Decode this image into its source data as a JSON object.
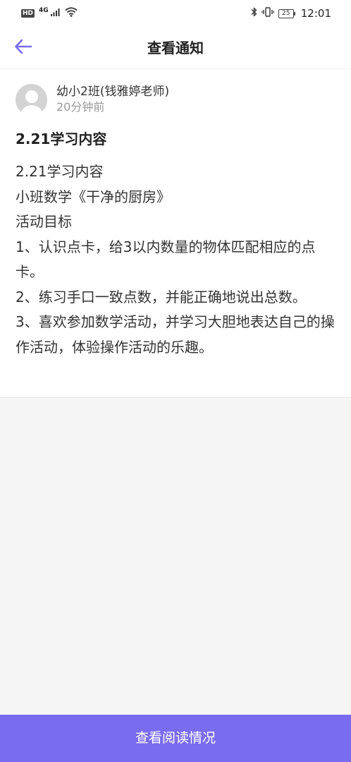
{
  "status_bar": {
    "hd": "HD",
    "network": "4G",
    "battery": "25",
    "time": "12:01"
  },
  "header": {
    "title": "查看通知"
  },
  "notice": {
    "author": "幼小2班(钱雅婷老师)",
    "time": "20分钟前",
    "title": "2.21学习内容",
    "lines": [
      "2.21学习内容",
      "小班数学《干净的厨房》",
      "活动目标",
      "1、认识点卡，给3以内数量的物体匹配相应的点卡。",
      "2、练习手口一致点数，并能正确地说出总数。",
      "3、喜欢参加数学活动，并学习大胆地表达自己的操作活动，体验操作活动的乐趣。"
    ]
  },
  "footer": {
    "button_label": "查看阅读情况"
  },
  "colors": {
    "accent": "#7a6cf0",
    "background": "#f5f5f5"
  },
  "icons": {
    "back": "arrow-left-icon",
    "signal": "signal-icon",
    "wifi": "wifi-icon",
    "bluetooth": "bluetooth-icon",
    "vibrate": "vibrate-icon",
    "battery": "battery-icon",
    "avatar": "default-avatar-icon"
  }
}
